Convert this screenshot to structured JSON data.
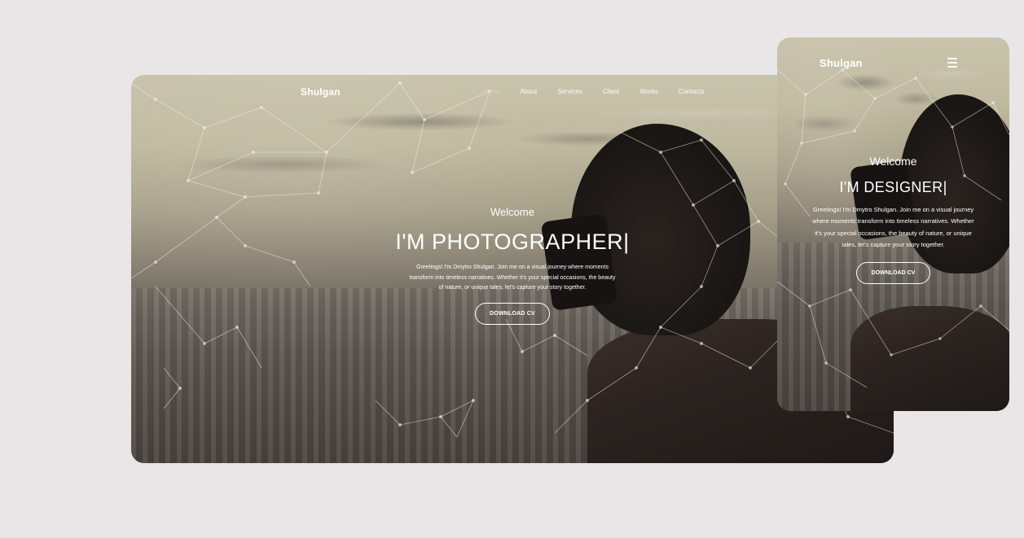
{
  "desktop": {
    "brand": "Shulgan",
    "nav": [
      "Home",
      "About",
      "Services",
      "Client",
      "Works",
      "Contacts"
    ],
    "hero": {
      "welcome": "Welcome",
      "headline": "I'M PHOTOGRAPHER|",
      "paragraph": "Greetings! I'm Dmytro Shulgan. Join me on a visual journey where moments transform into timeless narratives. Whether it's your special occasions, the beauty of nature, or unique tales, let's capture your story together.",
      "button": "DOWNLOAD CV"
    }
  },
  "mobile": {
    "brand": "Shulgan",
    "menu_icon": "hamburger-icon",
    "hero": {
      "welcome": "Welcome",
      "headline": "I'M DESIGNER|",
      "paragraph": "Greetings! I'm Dmytro Shulgan. Join me on a visual journey where moments transform into timeless narratives. Whether it's your special occasions, the beauty of nature, or unique tales, let's capture your story together.",
      "button": "DOWNLOAD CV"
    }
  },
  "colors": {
    "page_background": "#e8e6e6",
    "text": "#ffffff",
    "sky": "#c9c4ad",
    "shadow": "#1c1816"
  }
}
